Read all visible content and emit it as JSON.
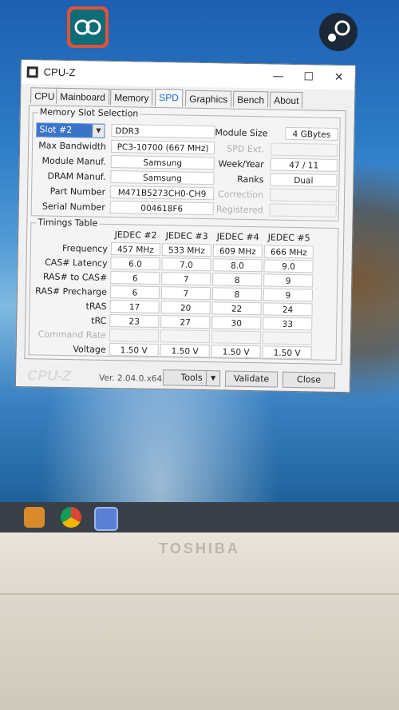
{
  "window": {
    "title": "CPU-Z",
    "minimize": "—",
    "maximize": "☐",
    "close": "✕"
  },
  "tabs": [
    {
      "label": "CPU"
    },
    {
      "label": "Mainboard"
    },
    {
      "label": "Memory"
    },
    {
      "label": "SPD",
      "active": true
    },
    {
      "label": "Graphics"
    },
    {
      "label": "Bench"
    },
    {
      "label": "About"
    }
  ],
  "slot_selection": {
    "group_title": "Memory Slot Selection",
    "slot_value": "Slot #2",
    "memory_type": "DDR3",
    "module_size_label": "Module Size",
    "module_size": "4 GBytes",
    "max_bandwidth_label": "Max Bandwidth",
    "max_bandwidth": "PC3-10700 (667 MHz)",
    "spd_ext_label": "SPD Ext.",
    "module_manuf_label": "Module Manuf.",
    "module_manuf": "Samsung",
    "week_year_label": "Week/Year",
    "week_year": "47 / 11",
    "dram_manuf_label": "DRAM Manuf.",
    "dram_manuf": "Samsung",
    "ranks_label": "Ranks",
    "ranks": "Dual",
    "part_number_label": "Part Number",
    "part_number": "M471B5273CH0-CH9",
    "correction_label": "Correction",
    "serial_number_label": "Serial Number",
    "serial_number": "004618F6",
    "registered_label": "Registered"
  },
  "timings": {
    "group_title": "Timings Table",
    "columns": [
      "JEDEC #2",
      "JEDEC #3",
      "JEDEC #4",
      "JEDEC #5"
    ],
    "rows": [
      {
        "label": "Frequency",
        "values": [
          "457 MHz",
          "533 MHz",
          "609 MHz",
          "666 MHz"
        ]
      },
      {
        "label": "CAS# Latency",
        "values": [
          "6.0",
          "7.0",
          "8.0",
          "9.0"
        ]
      },
      {
        "label": "RAS# to CAS#",
        "values": [
          "6",
          "7",
          "8",
          "9"
        ]
      },
      {
        "label": "RAS# Precharge",
        "values": [
          "6",
          "7",
          "8",
          "9"
        ]
      },
      {
        "label": "tRAS",
        "values": [
          "17",
          "20",
          "22",
          "24"
        ]
      },
      {
        "label": "tRC",
        "values": [
          "23",
          "27",
          "30",
          "33"
        ]
      },
      {
        "label": "Command Rate",
        "values": [
          "",
          "",
          "",
          ""
        ],
        "dim": true
      },
      {
        "label": "Voltage",
        "values": [
          "1.50 V",
          "1.50 V",
          "1.50 V",
          "1.50 V"
        ]
      }
    ]
  },
  "footer": {
    "logo": "CPU-Z",
    "version": "Ver. 2.04.0.x64",
    "tools": "Tools",
    "validate": "Validate",
    "close": "Close"
  },
  "bezel": {
    "brand": "TOSHIBA"
  },
  "colors": {
    "accent": "#1a6fd0",
    "select_bg": "#3a73c8"
  }
}
